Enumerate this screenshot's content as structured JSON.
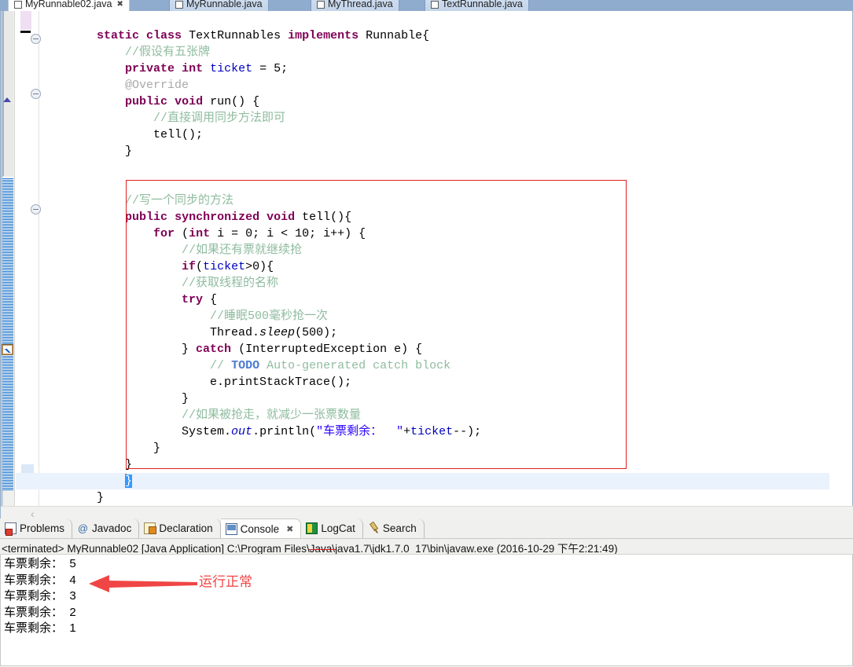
{
  "editor": {
    "tabs": [
      {
        "label": "MyRunnable02.java",
        "active": true,
        "closable": true,
        "icon": "java-file-icon"
      },
      {
        "label": "MyRunnable.java",
        "active": false,
        "closable": false,
        "icon": "java-file-icon"
      },
      {
        "label": "MyThread.java",
        "active": false,
        "closable": false,
        "icon": "java-file-icon"
      },
      {
        "label": "TextRunnable.java",
        "active": false,
        "closable": false,
        "icon": "java-file-icon"
      }
    ],
    "code_lines": [
      {
        "indent": 0,
        "html": ""
      },
      {
        "indent": 0,
        "html": "        <span class=\"kw\">static</span> <span class=\"kw\">class</span> TextRunnables <span class=\"kw\">implements</span> Runnable{"
      },
      {
        "indent": 0,
        "html": "            <span class=\"cm\">//假设有五张牌</span>"
      },
      {
        "indent": 0,
        "html": "            <span class=\"kw\">private</span> <span class=\"kw\">int</span> <span class=\"fld\">ticket</span> = 5;"
      },
      {
        "indent": 0,
        "html": "            <span class=\"ann\">@Override</span>"
      },
      {
        "indent": 0,
        "html": "            <span class=\"kw\">public</span> <span class=\"kw\">void</span> run() {"
      },
      {
        "indent": 0,
        "html": "                <span class=\"cm\">//直接调用同步方法即可</span>"
      },
      {
        "indent": 0,
        "html": "                tell();"
      },
      {
        "indent": 0,
        "html": "            }"
      },
      {
        "indent": 0,
        "html": ""
      },
      {
        "indent": 0,
        "html": ""
      },
      {
        "indent": 0,
        "html": "            <span class=\"cm\">//写一个同步的方法</span>"
      },
      {
        "indent": 0,
        "html": "            <span class=\"kw\">public</span> <span class=\"kw\">synchronized</span> <span class=\"kw\">void</span> tell(){"
      },
      {
        "indent": 0,
        "html": "                <span class=\"kw\">for</span> (<span class=\"kw\">int</span> i = 0; i &lt; 10; i++) {"
      },
      {
        "indent": 0,
        "html": "                    <span class=\"cm\">//如果还有票就继续抢</span>"
      },
      {
        "indent": 0,
        "html": "                    <span class=\"kw\">if</span>(<span class=\"fld\">ticket</span>&gt;0){"
      },
      {
        "indent": 0,
        "html": "                    <span class=\"cm\">//获取线程的名称</span>"
      },
      {
        "indent": 0,
        "html": "                    <span class=\"kw\">try</span> {"
      },
      {
        "indent": 0,
        "html": "                        <span class=\"cm\">//睡眠500毫秒抢一次</span>"
      },
      {
        "indent": 0,
        "html": "                        Thread.<span style=\"font-style:italic\">sleep</span>(500);"
      },
      {
        "indent": 0,
        "html": "                    } <span class=\"kw\">catch</span> (InterruptedException e) {"
      },
      {
        "indent": 0,
        "html": "                        <span class=\"cm\">// <span class=\"todo\">TODO</span> Auto-generated catch block</span>"
      },
      {
        "indent": 0,
        "html": "                        e.printStackTrace();"
      },
      {
        "indent": 0,
        "html": "                    }"
      },
      {
        "indent": 0,
        "html": "                    <span class=\"cm\">//如果被抢走，就减少一张票数量</span>"
      },
      {
        "indent": 0,
        "html": "                    System.<span class=\"fldi\">out</span>.println(<span class=\"str\">\"车票剩余：  \"</span>+<span class=\"fld\">ticket</span>--);"
      },
      {
        "indent": 0,
        "html": "                }"
      },
      {
        "indent": 0,
        "html": "            }"
      },
      {
        "indent": 0,
        "html": "CURLINE"
      },
      {
        "indent": 0,
        "html": "        }"
      }
    ],
    "current_line_text": "}",
    "annotation_box_color": "#e02020",
    "fold_markers": 3,
    "footer_chevron": "‹"
  },
  "bottom_panel": {
    "tabs": [
      {
        "label": "Problems",
        "icon": "problems-icon",
        "active": false,
        "closable": false
      },
      {
        "label": "Javadoc",
        "icon": "javadoc-icon",
        "active": false,
        "closable": false
      },
      {
        "label": "Declaration",
        "icon": "declaration-icon",
        "active": false,
        "closable": false
      },
      {
        "label": "Console",
        "icon": "console-icon",
        "active": true,
        "closable": true
      },
      {
        "label": "LogCat",
        "icon": "logcat-icon",
        "active": false,
        "closable": false
      },
      {
        "label": "Search",
        "icon": "search-icon",
        "active": false,
        "closable": false
      }
    ],
    "terminated_line": {
      "status": "<terminated>",
      "program": "MyRunnable02",
      "launch_type": "[Java Application]",
      "path_prefix": "C:\\Program Files\\",
      "path_struck": "Java\\",
      "path_suffix": "java1.7\\jdk1.7.0_17\\bin\\javaw.exe",
      "timestamp": "(2016-10-29 下午2:21:49)"
    },
    "console_output": [
      "车票剩余：  5",
      "车票剩余：  4",
      "车票剩余：  3",
      "车票剩余：  2",
      "车票剩余：  1"
    ],
    "annotation": {
      "text": "运行正常",
      "color": "#f04545",
      "arrow": "left-arrow"
    }
  },
  "colors": {
    "keyword": "#7f0055",
    "comment": "#8fbc9f",
    "string": "#2a00ff",
    "field": "#0000c0",
    "todo": "#4a7bd0",
    "annotation_red": "#e02020",
    "tab_strip": "#8fabcd",
    "current_line": "#eaf2fd",
    "selection": "#3399ff"
  }
}
